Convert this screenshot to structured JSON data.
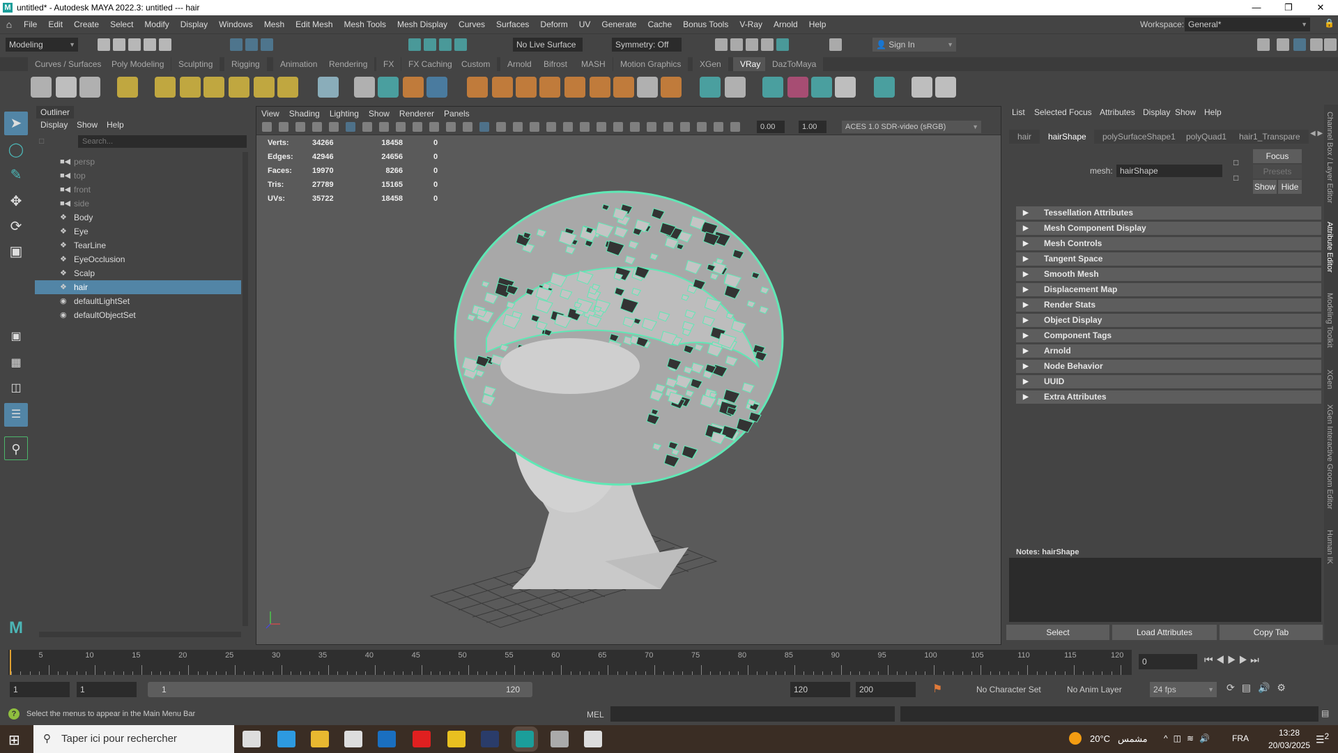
{
  "title": "untitled* - Autodesk MAYA 2022.3: untitled  ---  hair",
  "menu": [
    "File",
    "Edit",
    "Create",
    "Select",
    "Modify",
    "Display",
    "Windows",
    "Mesh",
    "Edit Mesh",
    "Mesh Tools",
    "Mesh Display",
    "Curves",
    "Surfaces",
    "Deform",
    "UV",
    "Generate",
    "Cache",
    "Bonus Tools",
    "V-Ray",
    "Arnold",
    "Help"
  ],
  "workspace": {
    "label": "Workspace:",
    "value": "General*"
  },
  "statusline": {
    "mode": "Modeling",
    "live_surface": "No Live Surface",
    "symmetry": "Symmetry: Off",
    "sign_in": "Sign In"
  },
  "shelf_tabs": [
    "Curves / Surfaces",
    "Poly Modeling",
    "Sculpting",
    "Rigging",
    "Animation",
    "Rendering",
    "FX",
    "FX Caching",
    "Custom",
    "Arnold",
    "Bifrost",
    "MASH",
    "Motion Graphics",
    "XGen",
    "VRay",
    "DazToMaya"
  ],
  "active_shelf": "VRay",
  "outliner": {
    "title": "Outliner",
    "menu": [
      "Display",
      "Show",
      "Help"
    ],
    "search_placeholder": "Search...",
    "items": [
      {
        "label": "persp",
        "type": "camera"
      },
      {
        "label": "top",
        "type": "camera"
      },
      {
        "label": "front",
        "type": "camera"
      },
      {
        "label": "side",
        "type": "camera"
      },
      {
        "label": "Body",
        "type": "mesh"
      },
      {
        "label": "Eye",
        "type": "mesh"
      },
      {
        "label": "TearLine",
        "type": "mesh"
      },
      {
        "label": "EyeOcclusion",
        "type": "mesh"
      },
      {
        "label": "Scalp",
        "type": "mesh"
      },
      {
        "label": "hair",
        "type": "mesh",
        "selected": true
      },
      {
        "label": "defaultLightSet",
        "type": "set"
      },
      {
        "label": "defaultObjectSet",
        "type": "set"
      }
    ]
  },
  "viewport": {
    "menu": [
      "View",
      "Shading",
      "Lighting",
      "Show",
      "Renderer",
      "Panels"
    ],
    "exposure": "0.00",
    "gamma": "1.00",
    "color_space": "ACES 1.0 SDR-video (sRGB)",
    "stats": [
      {
        "label": "Verts:",
        "a": "34266",
        "b": "18458",
        "c": "0"
      },
      {
        "label": "Edges:",
        "a": "42946",
        "b": "24656",
        "c": "0"
      },
      {
        "label": "Faces:",
        "a": "19970",
        "b": "8266",
        "c": "0"
      },
      {
        "label": "Tris:",
        "a": "27789",
        "b": "15165",
        "c": "0"
      },
      {
        "label": "UVs:",
        "a": "35722",
        "b": "18458",
        "c": "0"
      }
    ]
  },
  "attribute_editor": {
    "menu": [
      "List",
      "Selected",
      "Focus",
      "Attributes",
      "Display",
      "Show",
      "Help"
    ],
    "tabs": [
      "hair",
      "hairShape",
      "polySurfaceShape1",
      "polyQuad1",
      "hair1_Transpare"
    ],
    "active_tab": "hairShape",
    "mesh_label": "mesh:",
    "mesh_value": "hairShape",
    "focus": "Focus",
    "presets": "Presets",
    "show": "Show",
    "hide": "Hide",
    "sections": [
      "Tessellation Attributes",
      "Mesh Component Display",
      "Mesh Controls",
      "Tangent Space",
      "Smooth Mesh",
      "Displacement Map",
      "Render Stats",
      "Object Display",
      "Component Tags",
      "Arnold",
      "Node Behavior",
      "UUID",
      "Extra Attributes"
    ],
    "notes_label": "Notes:  hairShape",
    "buttons": [
      "Select",
      "Load Attributes",
      "Copy Tab"
    ]
  },
  "side_tabs": [
    "Channel Box / Layer Editor",
    "Attribute Editor",
    "Modeling Toolkit",
    "XGen",
    "XGen Interactive Groom Editor",
    "Human IK"
  ],
  "timeline": {
    "ticks": [
      5,
      10,
      15,
      20,
      25,
      30,
      35,
      40,
      45,
      50,
      55,
      60,
      65,
      70,
      75,
      80,
      85,
      90,
      95,
      100,
      105,
      110,
      115,
      120
    ],
    "current_frame": "0",
    "range_start": "1",
    "playback_start": "1",
    "slider_start": "1",
    "slider_end": "120",
    "playback_end": "120",
    "range_end": "200",
    "character_set": "No Character Set",
    "anim_layer": "No Anim Layer",
    "fps": "24 fps"
  },
  "command": {
    "help": "Select the menus to appear in the Main Menu Bar",
    "lang": "MEL"
  },
  "taskbar": {
    "search": "Taper ici pour rechercher",
    "weather": "20°C",
    "weather_text": "مشمس",
    "lang": "FRA",
    "time": "13:28",
    "date": "20/03/2025",
    "notif": "2"
  }
}
